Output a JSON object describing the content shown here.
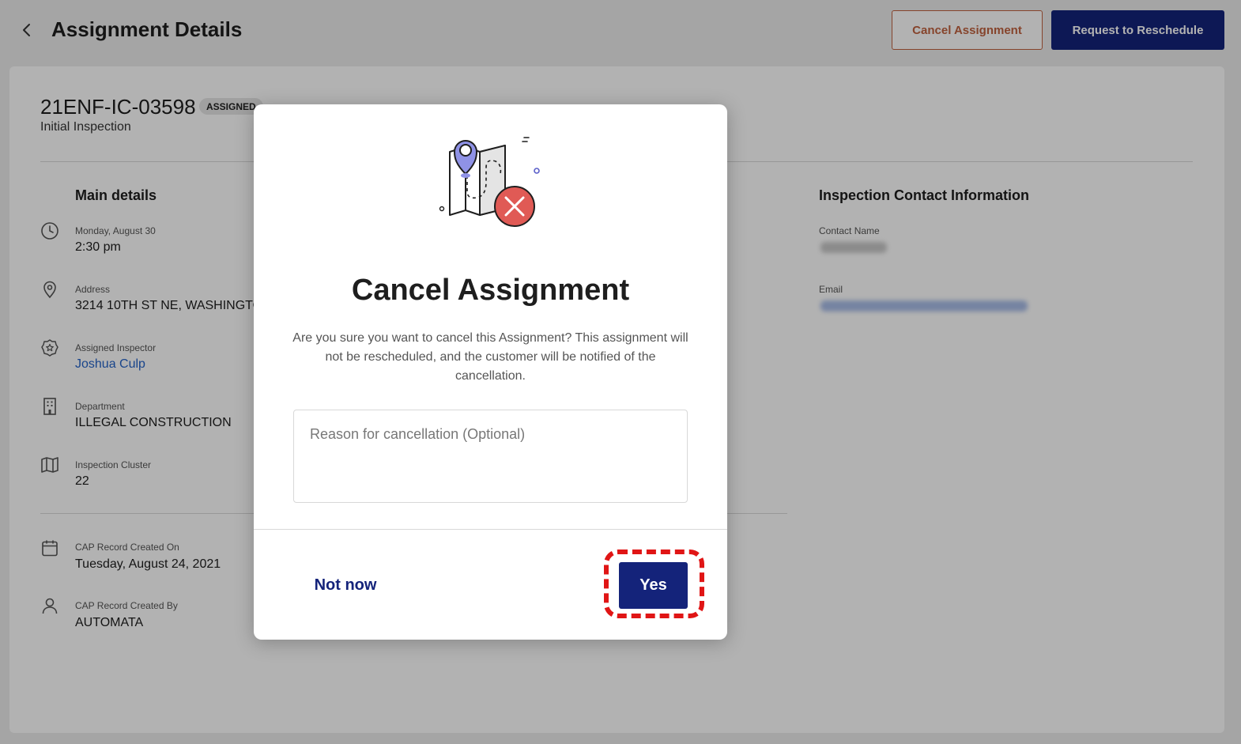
{
  "header": {
    "title": "Assignment Details",
    "cancel_button": "Cancel Assignment",
    "reschedule_button": "Request to Reschedule"
  },
  "record": {
    "id": "21ENF-IC-03598",
    "status": "ASSIGNED",
    "type": "Initial Inspection"
  },
  "main_details": {
    "title": "Main details",
    "items": [
      {
        "icon": "clock-icon",
        "label": "Monday, August 30",
        "value": "2:30 pm"
      },
      {
        "icon": "location-pin-icon",
        "label": "Address",
        "value": "3214 10TH ST NE, WASHINGTON"
      },
      {
        "icon": "badge-icon",
        "label": "Assigned Inspector",
        "value": "Joshua Culp"
      },
      {
        "icon": "building-icon",
        "label": "Department",
        "value": "ILLEGAL CONSTRUCTION"
      },
      {
        "icon": "map-icon",
        "label": "Inspection Cluster",
        "value": "22"
      }
    ],
    "record_items": [
      {
        "icon": "calendar-icon",
        "label": "CAP Record Created On",
        "value": "Tuesday, August 24, 2021"
      },
      {
        "icon": "user-icon",
        "label": "CAP Record Created By",
        "value": "AUTOMATA"
      }
    ]
  },
  "contact": {
    "title": "Inspection Contact Information",
    "name_label": "Contact Name",
    "email_label": "Email"
  },
  "modal": {
    "title": "Cancel Assignment",
    "body": "Are you sure you want to cancel this Assignment? This assignment will not be rescheduled, and the customer will be notified of the cancellation.",
    "reason_placeholder": "Reason for cancellation (Optional)",
    "reason_value": "",
    "not_now_button": "Not now",
    "yes_button": "Yes"
  },
  "colors": {
    "primary": "#14237a",
    "cancel_accent": "#c0623f",
    "link": "#2563c8",
    "highlight": "#e01515",
    "illustration_pin": "#8f92e6",
    "illustration_error": "#e05a55"
  }
}
